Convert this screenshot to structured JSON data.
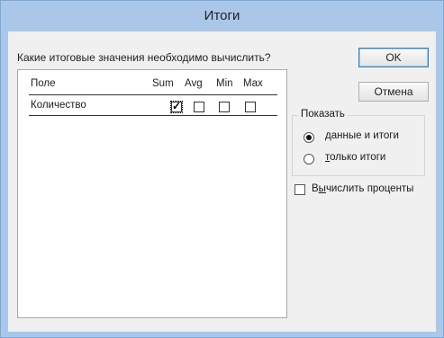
{
  "window": {
    "title": "Итоги"
  },
  "question": "Какие итоговые значения необходимо вычислить?",
  "list": {
    "columns": {
      "field": "Поле",
      "sum": "Sum",
      "avg": "Avg",
      "min": "Min",
      "max": "Max"
    },
    "rows": [
      {
        "field": "Количество",
        "sum": true,
        "avg": false,
        "min": false,
        "max": false
      }
    ]
  },
  "buttons": {
    "ok": "OK",
    "cancel": "Отмена"
  },
  "show_group": {
    "label": "Показать",
    "options": [
      {
        "prefix": "",
        "accel": "д",
        "rest": "анные и итоги",
        "selected": true
      },
      {
        "prefix": "",
        "accel": "т",
        "rest": "олько итоги",
        "selected": false
      }
    ]
  },
  "percent_checkbox": {
    "prefix": "В",
    "accel": "ы",
    "rest": "числить проценты",
    "checked": false
  }
}
